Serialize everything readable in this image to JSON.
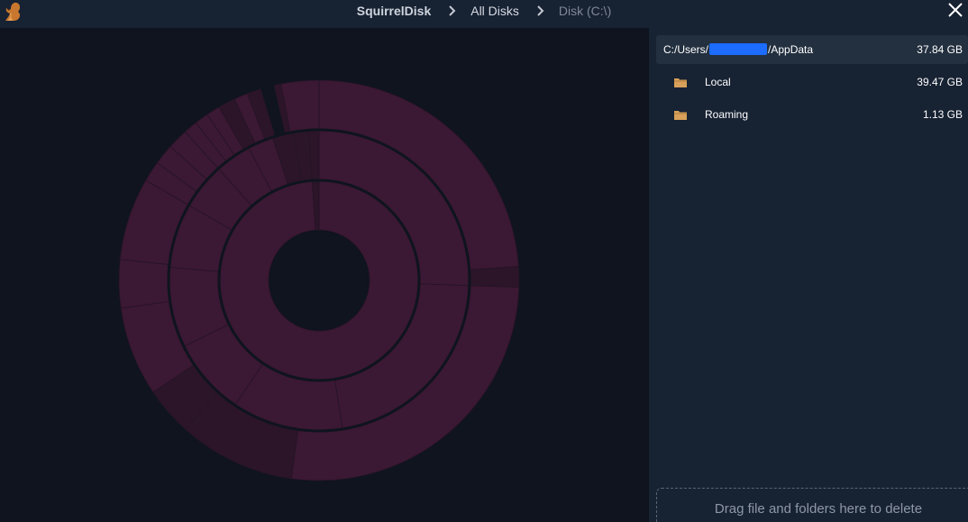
{
  "breadcrumb": {
    "app": "SquirrelDisk",
    "all_disks": "All Disks",
    "current": "Disk (C:\\)"
  },
  "current_path": {
    "prefix": "C:/Users/",
    "suffix": "/AppData",
    "size": "37.84 GB"
  },
  "folders": [
    {
      "name": "Local",
      "size": "39.47 GB"
    },
    {
      "name": "Roaming",
      "size": "1.13 GB"
    }
  ],
  "drop_zone": {
    "label": "Drag file and folders here to delete"
  },
  "colors": {
    "titlebar": "#172233",
    "chart_bg": "#0f141e",
    "panel_bg": "#172233",
    "segment": "#3b1834",
    "segment_dark": "#2c1529",
    "folder": "#d8a05a"
  },
  "icons": [
    "squirrel-logo-icon",
    "chevron-right-icon",
    "close-icon",
    "folder-icon"
  ]
}
